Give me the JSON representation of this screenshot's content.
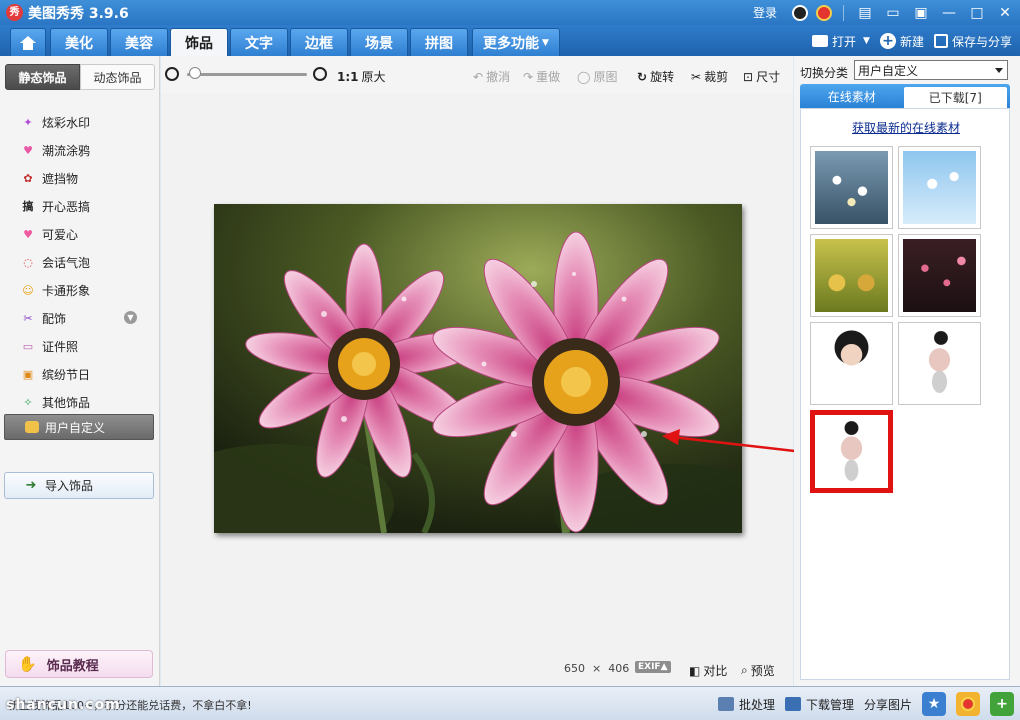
{
  "app": {
    "title": "美图秀秀 3.9.6",
    "logo_text": "秀"
  },
  "titlebar": {
    "login": "登录",
    "colors": {
      "bar": "#2a76c4"
    }
  },
  "tabs": [
    {
      "label": "",
      "icon": "home-icon"
    },
    {
      "label": "美化"
    },
    {
      "label": "美容"
    },
    {
      "label": "饰品",
      "active": true
    },
    {
      "label": "文字"
    },
    {
      "label": "边框"
    },
    {
      "label": "场景"
    },
    {
      "label": "拼图"
    },
    {
      "label": "更多功能"
    }
  ],
  "tab_actions": {
    "open": "打开",
    "new": "新建",
    "save_share": "保存与分享"
  },
  "left": {
    "subtabs": [
      "静态饰品",
      "动态饰品"
    ],
    "categories": [
      "炫彩水印",
      "潮流涂鸦",
      "遮挡物",
      "开心恶搞",
      "可爱心",
      "会话气泡",
      "卡通形象",
      "配饰",
      "证件照",
      "缤纷节日",
      "其他饰品"
    ],
    "selected_category": "用户自定义",
    "import_label": "导入饰品",
    "tutorial_label": "饰品教程",
    "icon_glyphs": [
      "✦",
      "♥",
      "✿",
      "搞",
      "♥",
      "◌",
      "☺",
      "✂",
      "▭",
      "▣",
      "✧"
    ]
  },
  "toolbar": {
    "zoom_ratio": "1:1",
    "original_size": "原大",
    "undo": "撤消",
    "redo": "重做",
    "original": "原图",
    "rotate": "旋转",
    "crop": "裁剪",
    "resize": "尺寸",
    "zoom_level": 0.05
  },
  "canvas": {
    "width": "650",
    "times": "×",
    "height": "406",
    "exif": "EXIF▲",
    "compare": "对比",
    "preview": "预览"
  },
  "right": {
    "switch_label": "切换分类",
    "switch_value": "用户自定义",
    "tabs": [
      "在线素材",
      "已下载[7]"
    ],
    "active_tab": 1,
    "link": "获取最新的在线素材",
    "thumbnails": [
      "daisies-blue",
      "daisies-sky",
      "flower-pots",
      "pink-blossoms",
      "girl-portrait",
      "girl-standing",
      "girl-standing-small"
    ]
  },
  "bottom": {
    "news": "新上线饰品100+，积分还能兑话费，不拿白不拿!",
    "watermark": "shancun.com",
    "batch": "批处理",
    "download_manager": "下载管理",
    "share_image": "分享图片"
  }
}
